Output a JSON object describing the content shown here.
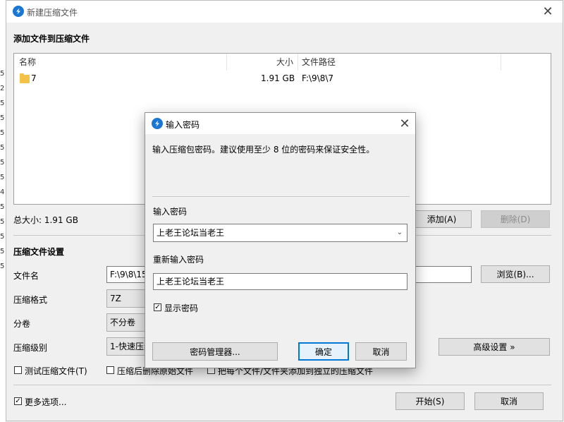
{
  "background_gutter": [
    "5",
    "2",
    "5",
    "5",
    "5",
    "5",
    "5",
    "5",
    "4",
    "5",
    "5",
    "5",
    "5",
    "5"
  ],
  "window": {
    "title": "新建压缩文件",
    "close_glyph": "✕"
  },
  "files_section": {
    "label": "添加文件到压缩文件",
    "columns": {
      "name": "名称",
      "size": "大小",
      "path": "文件路径"
    },
    "rows": [
      {
        "name": "7",
        "size": "1.91 GB",
        "path": "F:\\9\\8\\7",
        "icon": "folder-icon"
      }
    ],
    "total_size": "总大小: 1.91 GB",
    "add_button": "添加(A)",
    "delete_button": "删除(D)"
  },
  "settings": {
    "label": "压缩文件设置",
    "filename_label": "文件名",
    "filename_value": "F:\\9\\8\\15",
    "browse_button": "浏览(B)...",
    "format_label": "压缩格式",
    "format_value": "7Z",
    "split_label": "分卷",
    "split_value": "不分卷",
    "level_label": "压缩级别",
    "level_value": "1-快速压缩",
    "advanced_button": "高级设置 »",
    "test_checkbox": "测试压缩文件(T)",
    "delete_after_checkbox": "压缩后删除原始文件",
    "each_to_separate_checkbox": "把每个文件/文件夹添加到独立的压缩文件"
  },
  "footer": {
    "more_options": "更多选项...",
    "start_button": "开始(S)",
    "cancel_button": "取消"
  },
  "password_dialog": {
    "title": "输入密码",
    "hint": "输入压缩包密码。建议使用至少 8 位的密码来保证安全性。",
    "password_label": "输入密码",
    "password_value": "上老王论坛当老王",
    "confirm_label": "重新输入密码",
    "confirm_value": "上老王论坛当老王",
    "show_password": "显示密码",
    "manager_button": "密码管理器...",
    "ok_button": "确定",
    "cancel_button": "取消"
  },
  "colors": {
    "accent": "#0078d7",
    "app_icon": "#1976d2",
    "folder": "#f3c246"
  }
}
